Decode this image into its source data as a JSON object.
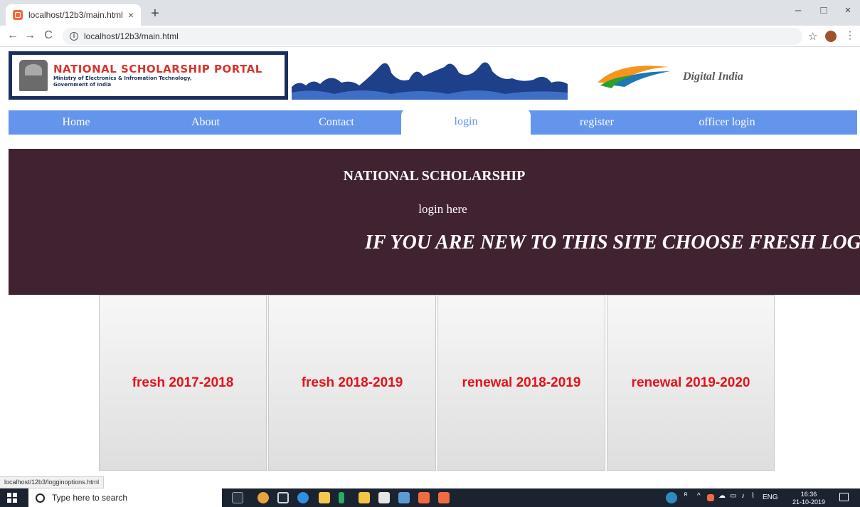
{
  "browser": {
    "tab_title": "localhost/12b3/main.html",
    "tab_close": "×",
    "new_tab": "+",
    "url": "localhost/12b3/main.html",
    "window_min": "–",
    "window_max": "□",
    "window_close": "×",
    "back": "←",
    "forward": "→",
    "reload": "C",
    "bookmark": "☆",
    "menu": "⋮"
  },
  "banner": {
    "title": "NATIONAL SCHOLARSHIP PORTAL",
    "subtitle_1": "Ministry of Electronics & Infromation Technology,",
    "subtitle_2": "Government of India",
    "digital_india": "Digital India"
  },
  "nav": {
    "items": [
      {
        "label": "Home"
      },
      {
        "label": "About"
      },
      {
        "label": "Contact"
      },
      {
        "label": "login"
      },
      {
        "label": "register"
      },
      {
        "label": "officer login"
      }
    ],
    "active_index": 3
  },
  "hero": {
    "title": "NATIONAL SCHOLARSHIP",
    "subtitle": "login here",
    "marquee": "IF YOU ARE NEW TO THIS SITE CHOOSE FRESH LOGIN OT"
  },
  "cards": [
    {
      "label": "fresh 2017-2018"
    },
    {
      "label": "fresh 2018-2019"
    },
    {
      "label": "renewal 2018-2019"
    },
    {
      "label": "renewal 2019-2020"
    }
  ],
  "status_url": "localhost/12b3/logginoptions.html",
  "taskbar": {
    "search_placeholder": "Type here to search",
    "lang": "ENG",
    "time": "16:36",
    "date": "21-10-2019"
  },
  "colors": {
    "nav_bg": "#6495ed",
    "hero_bg": "#412230",
    "card_text": "#e3121b",
    "banner_border": "#17305c"
  }
}
